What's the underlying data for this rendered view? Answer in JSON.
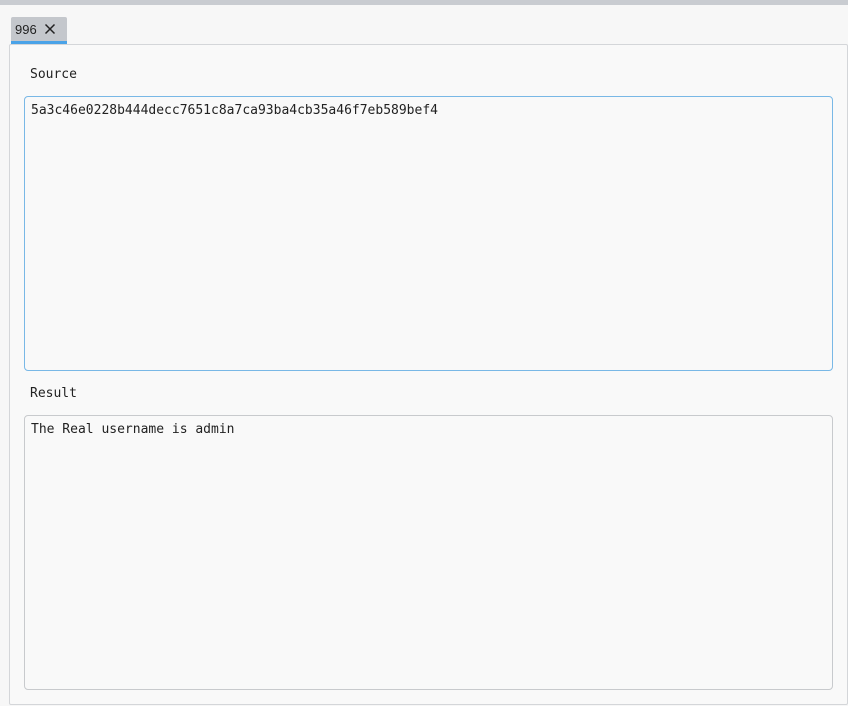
{
  "tab": {
    "label": "996",
    "close_icon": "close-icon"
  },
  "source": {
    "label": "Source",
    "value": "5a3c46e0228b444decc7651c8a7ca93ba4cb35a46f7eb589bef4"
  },
  "result": {
    "label": "Result",
    "value": "The Real username is admin"
  },
  "colors": {
    "tab_active_underline": "#4aa3e8",
    "source_border_focused": "#79b8e6"
  }
}
